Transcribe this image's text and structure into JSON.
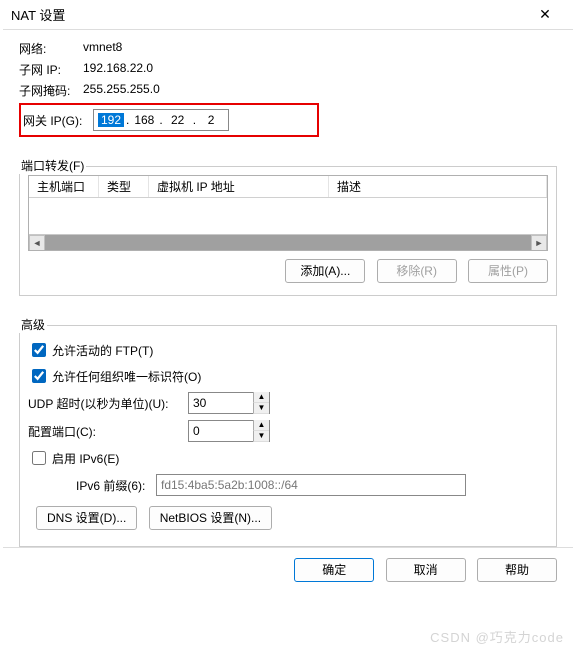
{
  "title": "NAT 设置",
  "info": {
    "network_label": "网络:",
    "network_value": "vmnet8",
    "subnet_ip_label": "子网 IP:",
    "subnet_ip_value": "192.168.22.0",
    "subnet_mask_label": "子网掩码:",
    "subnet_mask_value": "255.255.255.0",
    "gateway_label": "网关 IP(G):",
    "gateway_oct1": "192",
    "gateway_oct2": "168",
    "gateway_oct3": "22",
    "gateway_oct4": "2"
  },
  "portfwd": {
    "group_label": "端口转发(F)",
    "col_hostport": "主机端口",
    "col_type": "类型",
    "col_vmip": "虚拟机 IP 地址",
    "col_desc": "描述",
    "btn_add": "添加(A)...",
    "btn_remove": "移除(R)",
    "btn_props": "属性(P)"
  },
  "adv": {
    "group_label": "高级",
    "allow_ftp_label": "允许活动的 FTP(T)",
    "allow_ftp_checked": true,
    "allow_org_label": "允许任何组织唯一标识符(O)",
    "allow_org_checked": true,
    "udp_timeout_label": "UDP 超时(以秒为单位)(U):",
    "udp_timeout_value": "30",
    "config_port_label": "配置端口(C):",
    "config_port_value": "0",
    "enable_ipv6_label": "启用 IPv6(E)",
    "enable_ipv6_checked": false,
    "ipv6_prefix_label": "IPv6 前缀(6):",
    "ipv6_prefix_value": "fd15:4ba5:5a2b:1008::/64",
    "btn_dns": "DNS 设置(D)...",
    "btn_netbios": "NetBIOS 设置(N)..."
  },
  "buttons": {
    "ok": "确定",
    "cancel": "取消",
    "help": "帮助"
  },
  "watermark": "CSDN @巧克力code"
}
